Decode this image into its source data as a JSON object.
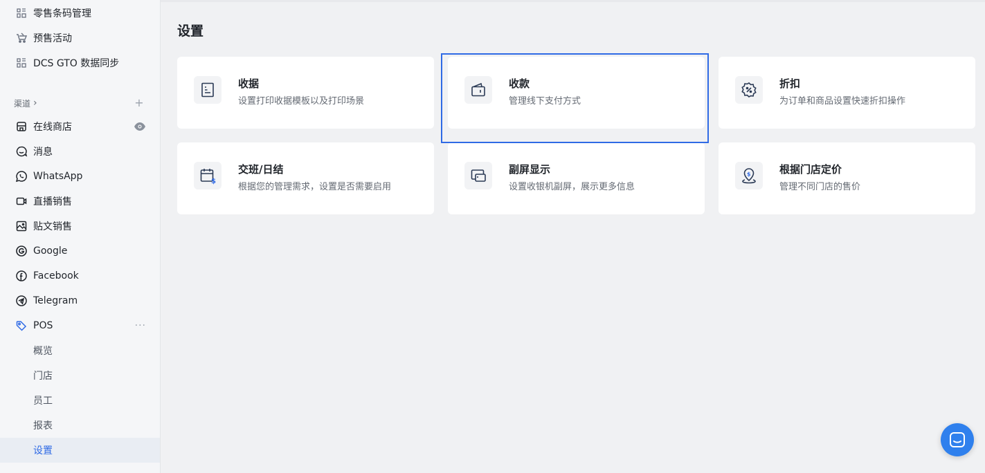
{
  "sidebar": {
    "top_items": [
      {
        "label": "零售条码管理",
        "icon": "grid-icon"
      },
      {
        "label": "预售活动",
        "icon": "cart-tag-icon"
      },
      {
        "label": "DCS GTO 数据同步",
        "icon": "grid-icon"
      }
    ],
    "channels_label": "渠道",
    "channels_chevron": "›",
    "add_symbol": "+",
    "channels": [
      {
        "label": "在线商店",
        "icon": "store-icon"
      },
      {
        "label": "消息",
        "icon": "chat-icon"
      },
      {
        "label": "WhatsApp",
        "icon": "whatsapp-icon"
      },
      {
        "label": "直播销售",
        "icon": "live-video-icon"
      },
      {
        "label": "贴文销售",
        "icon": "image-post-icon"
      },
      {
        "label": "Google",
        "icon": "google-icon"
      },
      {
        "label": "Facebook",
        "icon": "facebook-icon"
      },
      {
        "label": "Telegram",
        "icon": "telegram-icon"
      },
      {
        "label": "POS",
        "icon": "pos-tag-icon"
      }
    ],
    "pos_more": "···",
    "pos_sub": [
      {
        "label": "概览"
      },
      {
        "label": "门店"
      },
      {
        "label": "员工"
      },
      {
        "label": "报表"
      },
      {
        "label": "设置",
        "active": true
      }
    ]
  },
  "main": {
    "title": "设置",
    "cards": [
      {
        "title": "收据",
        "desc": "设置打印收据模板以及打印场景",
        "icon": "receipt-icon"
      },
      {
        "title": "收款",
        "desc": "管理线下支付方式",
        "icon": "wallet-icon"
      },
      {
        "title": "折扣",
        "desc": "为订单和商品设置快速折扣操作",
        "icon": "discount-badge-icon"
      },
      {
        "title": "交班/日结",
        "desc": "根据您的管理需求，设置是否需要启用",
        "icon": "calendar-dollar-icon"
      },
      {
        "title": "副屏显示",
        "desc": "设置收银机副屏，展示更多信息",
        "icon": "dual-screen-icon"
      },
      {
        "title": "根据门店定价",
        "desc": "管理不同门店的售价",
        "icon": "location-price-icon"
      }
    ]
  },
  "colors": {
    "accent": "#2f6ae5",
    "chat_button": "#2f80ed",
    "background": "#f0f1f3"
  }
}
